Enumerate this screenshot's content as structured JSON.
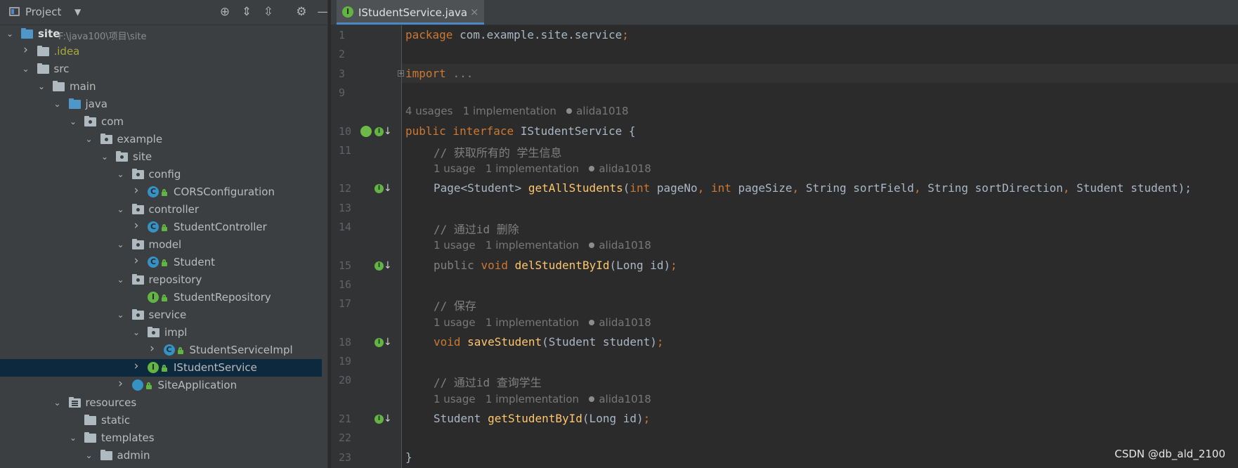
{
  "project_panel": {
    "title": "Project",
    "tree": [
      {
        "depth": 0,
        "expanded": true,
        "icon": "module-folder-icon",
        "label": "site",
        "path": "F:\\java100\\项目\\site",
        "bold": true
      },
      {
        "depth": 1,
        "expanded": false,
        "icon": "folder-icon",
        "label": ".idea"
      },
      {
        "depth": 1,
        "expanded": true,
        "icon": "folder-icon",
        "label": "src"
      },
      {
        "depth": 2,
        "expanded": true,
        "icon": "folder-icon",
        "label": "main"
      },
      {
        "depth": 3,
        "expanded": true,
        "icon": "source-folder-icon",
        "label": "java"
      },
      {
        "depth": 4,
        "expanded": true,
        "icon": "package-icon",
        "label": "com"
      },
      {
        "depth": 5,
        "expanded": true,
        "icon": "package-icon",
        "label": "example"
      },
      {
        "depth": 6,
        "expanded": true,
        "icon": "package-icon",
        "label": "site"
      },
      {
        "depth": 7,
        "expanded": true,
        "icon": "package-icon",
        "label": "config"
      },
      {
        "depth": 8,
        "expanded": false,
        "icon": "class-icon",
        "label": "CORSConfiguration"
      },
      {
        "depth": 7,
        "expanded": true,
        "icon": "package-icon",
        "label": "controller"
      },
      {
        "depth": 8,
        "expanded": false,
        "icon": "class-icon",
        "label": "StudentController"
      },
      {
        "depth": 7,
        "expanded": true,
        "icon": "package-icon",
        "label": "model"
      },
      {
        "depth": 8,
        "expanded": false,
        "icon": "class-icon",
        "label": "Student"
      },
      {
        "depth": 7,
        "expanded": true,
        "icon": "package-icon",
        "label": "repository"
      },
      {
        "depth": 8,
        "expanded": null,
        "icon": "interface-icon",
        "label": "StudentRepository"
      },
      {
        "depth": 7,
        "expanded": true,
        "icon": "package-icon",
        "label": "service"
      },
      {
        "depth": 8,
        "expanded": true,
        "icon": "package-icon",
        "label": "impl"
      },
      {
        "depth": 9,
        "expanded": false,
        "icon": "class-icon",
        "label": "StudentServiceImpl"
      },
      {
        "depth": 8,
        "expanded": false,
        "icon": "interface-icon",
        "label": "IStudentService",
        "selected": true
      },
      {
        "depth": 7,
        "expanded": false,
        "icon": "spring-app-icon",
        "label": "SiteApplication"
      },
      {
        "depth": 3,
        "expanded": true,
        "icon": "resources-folder-icon",
        "label": "resources"
      },
      {
        "depth": 4,
        "expanded": null,
        "icon": "folder-icon",
        "label": "static"
      },
      {
        "depth": 4,
        "expanded": true,
        "icon": "folder-icon",
        "label": "templates"
      },
      {
        "depth": 5,
        "expanded": true,
        "icon": "folder-icon",
        "label": "admin"
      }
    ]
  },
  "editor": {
    "tab_label": "IStudentService.java",
    "lines": [
      {
        "n": "1",
        "tokens": [
          [
            "kw",
            "package "
          ],
          [
            "",
            "com.example.site.service"
          ],
          [
            "kw",
            ";"
          ]
        ]
      },
      {
        "n": "2",
        "tokens": []
      },
      {
        "n": "3",
        "tokens": [
          [
            "kw",
            "import "
          ],
          [
            "fold",
            "..."
          ]
        ],
        "fold": true,
        "highlight": true
      },
      {
        "n": "9",
        "tokens": []
      },
      {
        "hint": true,
        "indent": 0,
        "text": [
          "4 usages",
          "1 implementation",
          "alida1018"
        ]
      },
      {
        "n": "10",
        "tokens": [
          [
            "kw",
            "public interface "
          ],
          [
            "",
            "IStudentService {"
          ]
        ],
        "gutter": "leaf"
      },
      {
        "n": "11",
        "indent": 1,
        "tokens": [
          [
            "cm",
            "// 获取所有的 学生信息"
          ]
        ]
      },
      {
        "hint": true,
        "indent": 1,
        "text": [
          "1 usage",
          "1 implementation",
          "alida1018"
        ]
      },
      {
        "n": "12",
        "indent": 1,
        "tokens": [
          [
            "",
            "Page<Student> "
          ],
          [
            "fn",
            "getAllStudents"
          ],
          [
            "",
            "("
          ],
          [
            "kw",
            "int "
          ],
          [
            "",
            "pageNo"
          ],
          [
            "kw",
            ", int "
          ],
          [
            "",
            "pageSize"
          ],
          [
            "kw",
            ", "
          ],
          [
            "",
            "String sortField"
          ],
          [
            "kw",
            ", "
          ],
          [
            "",
            "String sortDirection"
          ],
          [
            "kw",
            ", "
          ],
          [
            "",
            "Student student);"
          ]
        ],
        "gutter": "impl"
      },
      {
        "n": "13",
        "tokens": []
      },
      {
        "n": "14",
        "indent": 1,
        "tokens": [
          [
            "cm",
            "// 通过id 删除"
          ]
        ]
      },
      {
        "hint": true,
        "indent": 1,
        "text": [
          "1 usage",
          "1 implementation",
          "alida1018"
        ]
      },
      {
        "n": "15",
        "indent": 1,
        "tokens": [
          [
            "cm",
            "public "
          ],
          [
            "kw",
            "void "
          ],
          [
            "fn",
            "delStudentById"
          ],
          [
            "",
            "(Long id)"
          ],
          [
            "kw",
            ";"
          ]
        ],
        "gutter": "impl"
      },
      {
        "n": "16",
        "tokens": []
      },
      {
        "n": "17",
        "indent": 1,
        "tokens": [
          [
            "cm",
            "// 保存"
          ]
        ]
      },
      {
        "hint": true,
        "indent": 1,
        "text": [
          "1 usage",
          "1 implementation",
          "alida1018"
        ]
      },
      {
        "n": "18",
        "indent": 1,
        "tokens": [
          [
            "kw",
            "void "
          ],
          [
            "fn",
            "saveStudent"
          ],
          [
            "",
            "(Student student)"
          ],
          [
            "kw",
            ";"
          ]
        ],
        "gutter": "impl"
      },
      {
        "n": "19",
        "tokens": []
      },
      {
        "n": "20",
        "indent": 1,
        "tokens": [
          [
            "cm",
            "// 通过id 查询学生"
          ]
        ]
      },
      {
        "hint": true,
        "indent": 1,
        "text": [
          "1 usage",
          "1 implementation",
          "alida1018"
        ]
      },
      {
        "n": "21",
        "indent": 1,
        "tokens": [
          [
            "",
            "Student "
          ],
          [
            "fn",
            "getStudentById"
          ],
          [
            "",
            "(Long id)"
          ],
          [
            "kw",
            ";"
          ]
        ],
        "gutter": "impl"
      },
      {
        "n": "22",
        "tokens": []
      },
      {
        "n": "23",
        "tokens": [
          [
            "",
            "}"
          ]
        ]
      }
    ]
  },
  "watermark": "CSDN @db_ald_2100",
  "colors": {
    "keyword": "#cc7832",
    "function": "#ffc66d",
    "comment": "#808080",
    "text": "#a9b7c6",
    "selection": "#0d293e"
  }
}
